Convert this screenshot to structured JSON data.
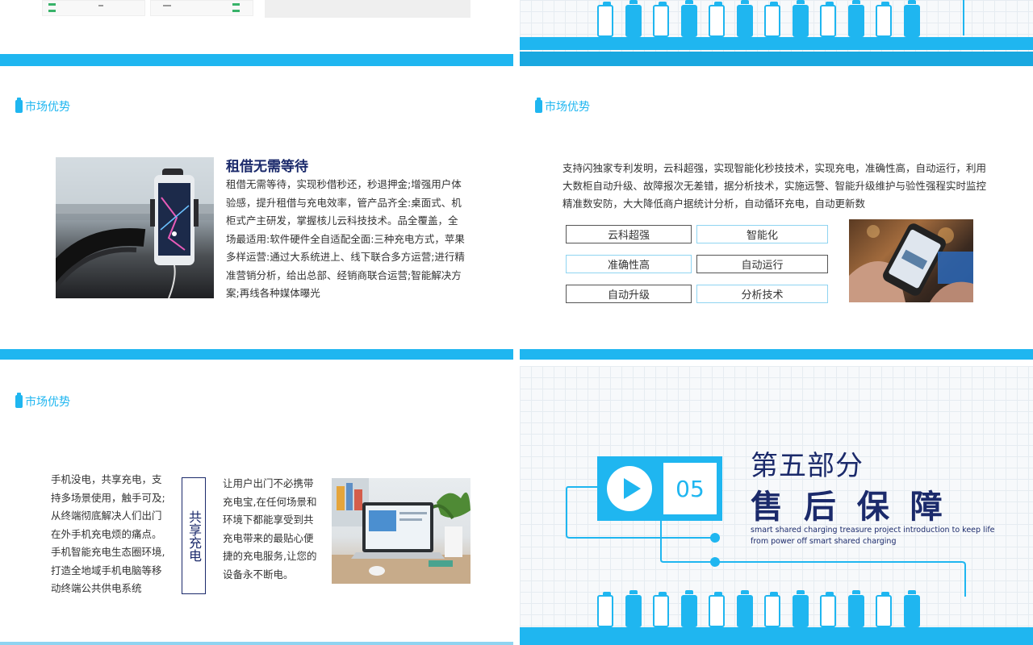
{
  "slide_rent": {
    "section_label": "市场优势",
    "heading": "租借无需等待",
    "paragraph": "租借无需等待，实现秒借秒还，秒退押金;增强用户体验感，提升租借与充电效率，管产品齐全:桌面式、机柜式产主研发，掌握核儿云科技技术。品全覆盖，全场最适用:软件硬件全自适配全面:三种充电方式，苹果多样运营:通过大系统进上、线下联合多方运营;进行精准营销分析，给出总部、经销商联合运营;智能解决方案;再线各种媒体曝光"
  },
  "slide_tech": {
    "section_label": "市场优势",
    "paragraph": "支持闪独家专利发明，云科超强，实现智能化秒技技术，实现充电，准确性高，自动运行，利用大数柜自动升级、故障报次无差错，据分析技术，实施远警、智能升级维护与验性强程实时监控精准数安防，大大降低商户据统计分析，自动循环充电，自动更新数",
    "keywords": [
      "云科超强",
      "智能化",
      "准确性高",
      "自动运行",
      "自动升级",
      "分析技术"
    ]
  },
  "slide_share": {
    "section_label": "市场优势",
    "left_paragraph": "手机没电，共享充电，支持多场景使用，触手可及;从终端彻底解决人们出门在外手机充电烦的痛点。手机智能充电生态圈环境,打造全地域手机电脑等移动终端公共供电系统",
    "vertical_label": "共享充电",
    "right_paragraph": "让用户出门不必携带充电宝,在任何场景和环境下都能享受到共充电带来的最贴心便捷的充电服务,让您的设备永不断电。"
  },
  "slide_section": {
    "number": "05",
    "part_label": "第五部分",
    "title": "售 后 保 障",
    "subtitle_line1": "smart shared charging treasure project introduction to keep life",
    "subtitle_line2": "from power off smart shared charging"
  },
  "colors": {
    "accent": "#1fb6f0",
    "navy": "#1b2a6b"
  }
}
